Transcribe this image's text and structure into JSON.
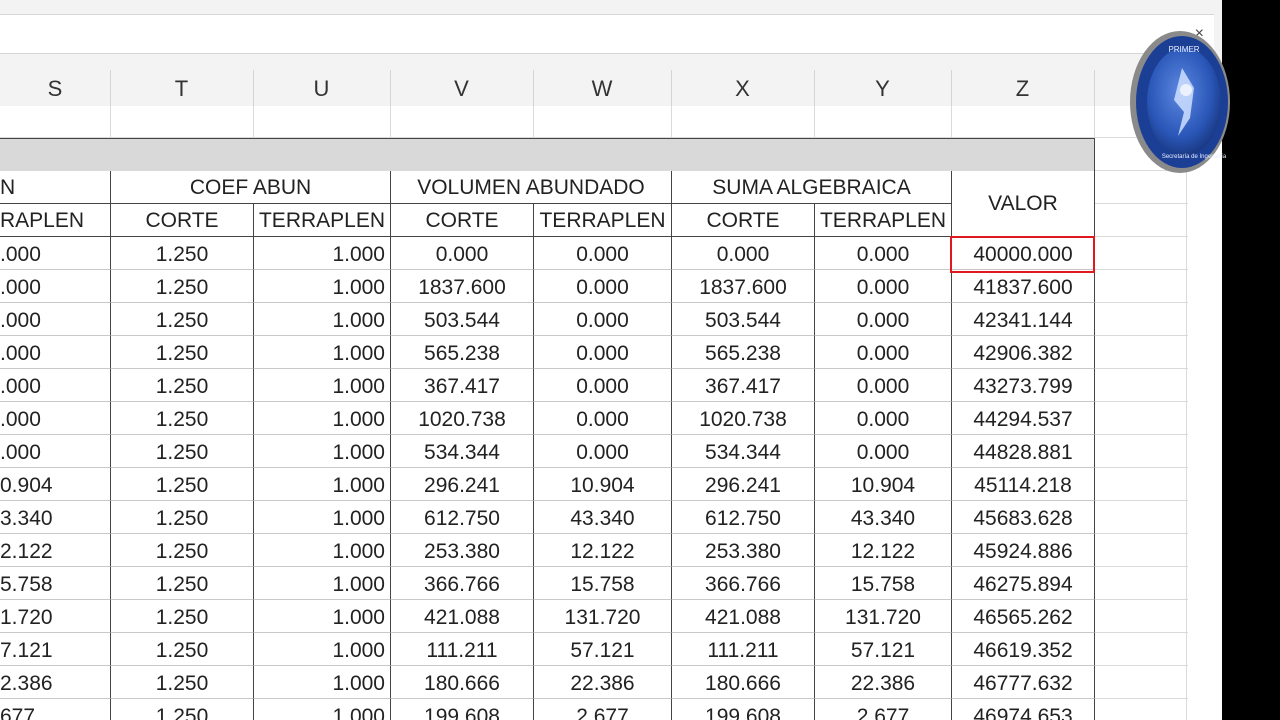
{
  "formula_bar": {
    "close_glyph": "×"
  },
  "column_headers": [
    "S",
    "T",
    "U",
    "V",
    "W",
    "X",
    "Y",
    "Z"
  ],
  "table": {
    "group_headers": {
      "col_s": "N",
      "coef_abun": "COEF ABUN",
      "volumen_abundado": "VOLUMEN ABUNDADO",
      "suma_algebraica": "SUMA ALGEBRAICA",
      "valor": "VALOR"
    },
    "sub_headers": {
      "s": "RAPLEN",
      "t": "CORTE",
      "u": "TERRAPLEN",
      "v": "CORTE",
      "w": "TERRAPLEN",
      "x": "CORTE",
      "y": "TERRAPLEN"
    },
    "rows": [
      [
        ".000",
        "1.250",
        "1.000",
        "0.000",
        "0.000",
        "0.000",
        "0.000",
        "40000.000"
      ],
      [
        ".000",
        "1.250",
        "1.000",
        "1837.600",
        "0.000",
        "1837.600",
        "0.000",
        "41837.600"
      ],
      [
        ".000",
        "1.250",
        "1.000",
        "503.544",
        "0.000",
        "503.544",
        "0.000",
        "42341.144"
      ],
      [
        ".000",
        "1.250",
        "1.000",
        "565.238",
        "0.000",
        "565.238",
        "0.000",
        "42906.382"
      ],
      [
        ".000",
        "1.250",
        "1.000",
        "367.417",
        "0.000",
        "367.417",
        "0.000",
        "43273.799"
      ],
      [
        ".000",
        "1.250",
        "1.000",
        "1020.738",
        "0.000",
        "1020.738",
        "0.000",
        "44294.537"
      ],
      [
        ".000",
        "1.250",
        "1.000",
        "534.344",
        "0.000",
        "534.344",
        "0.000",
        "44828.881"
      ],
      [
        "0.904",
        "1.250",
        "1.000",
        "296.241",
        "10.904",
        "296.241",
        "10.904",
        "45114.218"
      ],
      [
        "3.340",
        "1.250",
        "1.000",
        "612.750",
        "43.340",
        "612.750",
        "43.340",
        "45683.628"
      ],
      [
        "2.122",
        "1.250",
        "1.000",
        "253.380",
        "12.122",
        "253.380",
        "12.122",
        "45924.886"
      ],
      [
        "5.758",
        "1.250",
        "1.000",
        "366.766",
        "15.758",
        "366.766",
        "15.758",
        "46275.894"
      ],
      [
        "1.720",
        "1.250",
        "1.000",
        "421.088",
        "131.720",
        "421.088",
        "131.720",
        "46565.262"
      ],
      [
        "7.121",
        "1.250",
        "1.000",
        "111.211",
        "57.121",
        "111.211",
        "57.121",
        "46619.352"
      ],
      [
        "2.386",
        "1.250",
        "1.000",
        "180.666",
        "22.386",
        "180.666",
        "22.386",
        "46777.632"
      ],
      [
        "677",
        "1.250",
        "1.000",
        "199.608",
        "2.677",
        "199.608",
        "2.677",
        "46974.653"
      ]
    ]
  },
  "logo": {
    "text_top": "PRIMER",
    "text_bottom": "Secretaría de Ingeniería"
  },
  "colors": {
    "selection_border": "#e0191f",
    "header_underline": "#4457b5",
    "logo_blue": "#2a57b8"
  }
}
